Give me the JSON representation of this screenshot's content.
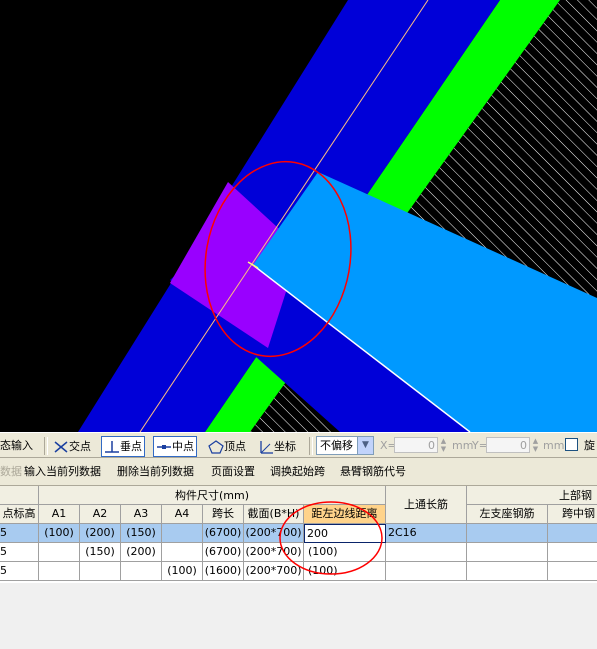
{
  "snap_toolbar": {
    "dynamic_input_label": "态输入",
    "snap_intersection": "交点",
    "snap_perpendicular": "垂点",
    "snap_midpoint": "中点",
    "snap_vertex": "顶点",
    "snap_coordinate": "坐标",
    "offset_select_value": "不偏移",
    "x_label": "X=",
    "x_value": "0",
    "x_unit": "mm",
    "y_label": "Y=",
    "y_value": "0",
    "y_unit": "mm",
    "rotate_label": "旋"
  },
  "table_toolbar": {
    "partial_item": "数据",
    "input_column": "输入当前列数据",
    "delete_column": "删除当前列数据",
    "page_setup": "页面设置",
    "swap_start_span": "调换起始跨",
    "cantilever_code": "悬臂钢筋代号"
  },
  "grid": {
    "group_header": "构件尺寸(mm)",
    "top_rebar_header": "上通长筋",
    "upper_rebar_group": "上部钢",
    "columns": {
      "elev": "点标高",
      "a1": "A1",
      "a2": "A2",
      "a3": "A3",
      "a4": "A4",
      "span": "跨长",
      "section": "截面(B*H)",
      "left_dist": "距左边线距离",
      "left_support": "左支座钢筋",
      "mid_span": "跨中钢"
    },
    "rows": [
      {
        "elev": "5",
        "a1": "(100)",
        "a2": "(200)",
        "a3": "(150)",
        "a4": "",
        "span": "(6700)",
        "section": "(200*700)",
        "left_dist": "200",
        "top_rebar": "2C16",
        "left_support": "",
        "mid_span": ""
      },
      {
        "elev": "5",
        "a1": "",
        "a2": "(150)",
        "a3": "(200)",
        "a4": "",
        "span": "(6700)",
        "section": "(200*700)",
        "left_dist": "(100)",
        "top_rebar": "",
        "left_support": "",
        "mid_span": ""
      },
      {
        "elev": "5",
        "a1": "",
        "a2": "",
        "a3": "",
        "a4": "(100)",
        "span": "(1600)",
        "section": "(200*700)",
        "left_dist": "(100)",
        "top_rebar": "",
        "left_support": "",
        "mid_span": ""
      }
    ]
  },
  "colors": {
    "canvas_bg": "#000000",
    "wall_blue": "#0000d8",
    "beam_cyan": "#0099ff",
    "green_band": "#00ff00",
    "purple_node": "#9900ff",
    "mark_red": "#ff0000",
    "selected_row": "#a8cbf0"
  }
}
